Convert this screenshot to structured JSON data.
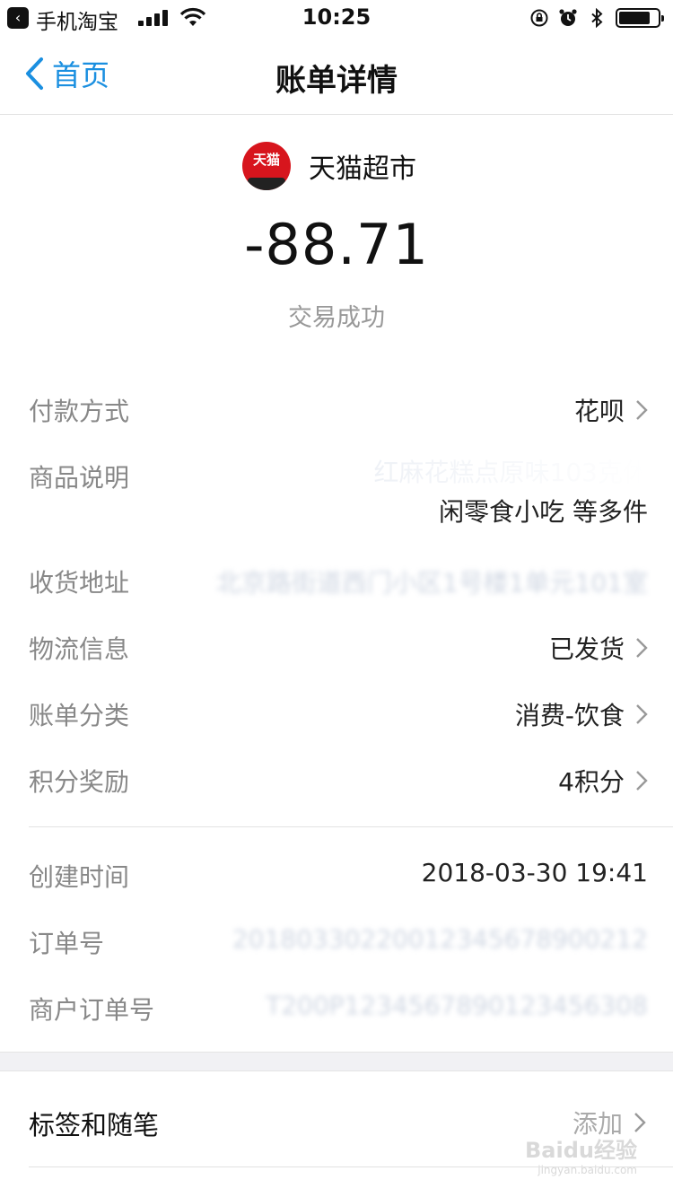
{
  "status_bar": {
    "back_app_label": "手机淘宝",
    "time": "10:25",
    "battery_level": 0.8
  },
  "nav": {
    "back_label": "首页",
    "title": "账单详情"
  },
  "header": {
    "merchant_logo_text": "天猫",
    "merchant_name": "天猫超市",
    "amount": "-88.71",
    "status": "交易成功"
  },
  "details": {
    "payment_method": {
      "label": "付款方式",
      "value": "花呗"
    },
    "product_desc": {
      "label": "商品说明",
      "value_line1": "红麻花糕点原味103克休",
      "value_line2": "闲零食小吃 等多件"
    },
    "address": {
      "label": "收货地址",
      "value": "北京路街道西门小区1号楼1单元101室"
    },
    "logistics": {
      "label": "物流信息",
      "value": "已发货"
    },
    "category": {
      "label": "账单分类",
      "value": "消费-饮食"
    },
    "points": {
      "label": "积分奖励",
      "value": "4积分"
    },
    "created_time": {
      "label": "创建时间",
      "value": "2018-03-30 19:41"
    },
    "order_no": {
      "label": "订单号",
      "value": "20180330220012345678900212"
    },
    "merchant_order_no": {
      "label": "商户订单号",
      "value": "T200P1234567890123456308"
    }
  },
  "tags": {
    "label": "标签和随笔",
    "action": "添加"
  },
  "watermark": {
    "brand": "Baidu经验",
    "url": "jingyan.baidu.com"
  }
}
